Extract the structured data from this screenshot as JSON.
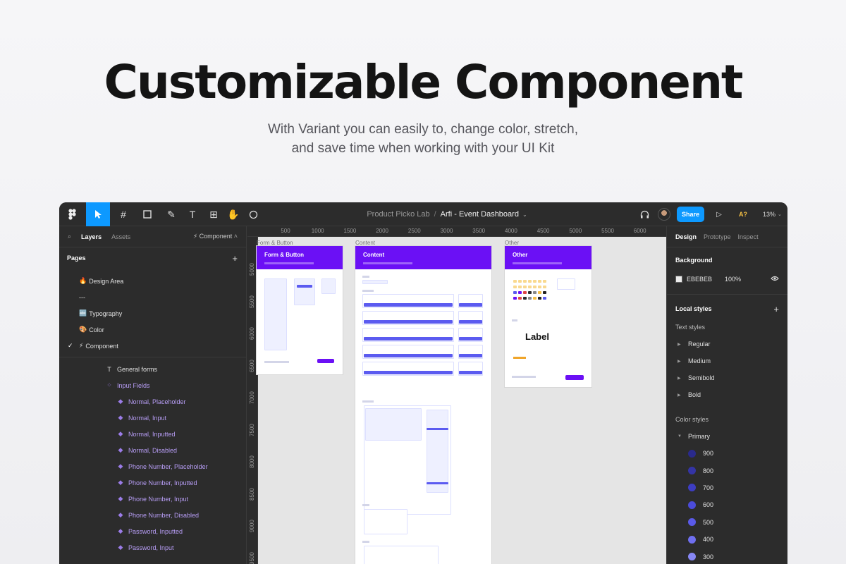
{
  "hero": {
    "title": "Customizable Component",
    "subtitle_line1": "With Variant you can easily to, change color, stretch,",
    "subtitle_line2": "and save time when working with your UI Kit"
  },
  "toolbar": {
    "project": "Product Picko Lab",
    "separator": "/",
    "file_name": "Arfi - Event Dashboard",
    "share_label": "Share",
    "zoom": "13%",
    "a_badge": "A?"
  },
  "left_panel": {
    "tabs": [
      "Layers",
      "Assets"
    ],
    "current_page": "⚡ Component",
    "pages_title": "Pages",
    "pages": [
      {
        "emoji": "🔥",
        "label": "Design Area",
        "selected": false
      },
      {
        "emoji": "",
        "label": "---",
        "selected": false
      },
      {
        "emoji": "🔤",
        "label": "Typography",
        "selected": false
      },
      {
        "emoji": "🎨",
        "label": "Color",
        "selected": false
      },
      {
        "emoji": "⚡",
        "label": "Component",
        "selected": true
      }
    ],
    "layers": [
      {
        "type": "group",
        "label": "General forms"
      },
      {
        "type": "set",
        "label": "Input Fields"
      },
      {
        "type": "comp",
        "label": "Normal, Placeholder"
      },
      {
        "type": "comp",
        "label": "Normal, Input"
      },
      {
        "type": "comp",
        "label": "Normal, Inputted"
      },
      {
        "type": "comp",
        "label": "Normal, Disabled"
      },
      {
        "type": "comp",
        "label": "Phone Number, Placeholder"
      },
      {
        "type": "comp",
        "label": "Phone Number, Inputted"
      },
      {
        "type": "comp",
        "label": "Phone Number, Input"
      },
      {
        "type": "comp",
        "label": "Phone Number, Disabled"
      },
      {
        "type": "comp",
        "label": "Password, Inputted"
      },
      {
        "type": "comp",
        "label": "Password, Input"
      }
    ]
  },
  "canvas": {
    "ruler_top": [
      "500",
      "1000",
      "1500",
      "2000",
      "2500",
      "3000",
      "3500",
      "4000",
      "4500",
      "5000",
      "5500",
      "6000"
    ],
    "ruler_left": [
      "5000",
      "5500",
      "6000",
      "6500",
      "7000",
      "7500",
      "8000",
      "8500",
      "9000",
      "9500"
    ],
    "frames": {
      "form": {
        "label": "Form & Button",
        "title": "Form & Button"
      },
      "content": {
        "label": "Content",
        "title": "Content"
      },
      "other": {
        "label": "Other",
        "title": "Other",
        "big_label": "Label"
      }
    }
  },
  "right_panel": {
    "tabs": [
      "Design",
      "Prototype",
      "Inspect"
    ],
    "background_title": "Background",
    "background_hex": "EBEBEB",
    "background_opacity": "100%",
    "local_styles_title": "Local styles",
    "text_styles_title": "Text styles",
    "text_styles": [
      "Regular",
      "Medium",
      "Semibold",
      "Bold"
    ],
    "color_styles_title": "Color styles",
    "color_group": "Primary",
    "colors": [
      {
        "label": "900",
        "hex": "#2a2a8c"
      },
      {
        "label": "800",
        "hex": "#3434a6"
      },
      {
        "label": "700",
        "hex": "#3d3dc2"
      },
      {
        "label": "600",
        "hex": "#4b4bd9"
      },
      {
        "label": "500",
        "hex": "#5a5ae8"
      },
      {
        "label": "400",
        "hex": "#6f6ff0"
      },
      {
        "label": "300",
        "hex": "#8787f4"
      }
    ]
  }
}
